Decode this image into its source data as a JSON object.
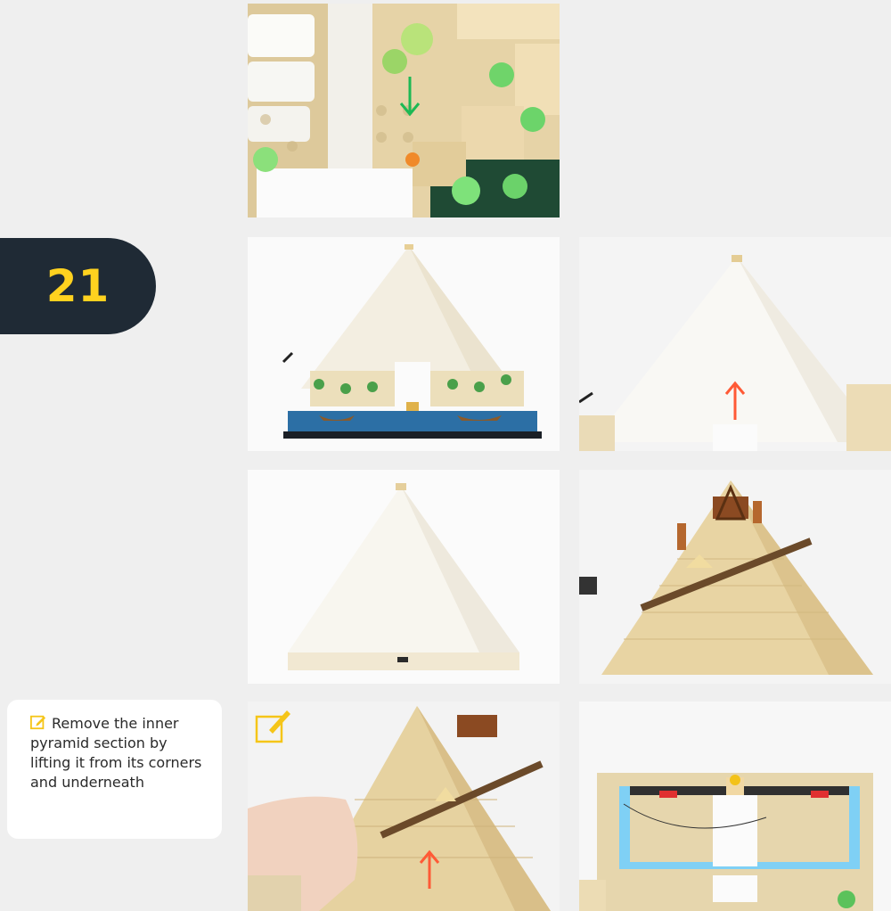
{
  "step": {
    "number": "21"
  },
  "note": {
    "icon": "edit-note-icon",
    "text": "Remove the inner pyramid section by lifting it from its corners and underneath"
  },
  "colors": {
    "badge_bg": "#1f2a35",
    "badge_text": "#ffd21f",
    "note_icon": "#f5c518",
    "arrow_green": "#1db954",
    "arrow_red": "#ff5a36",
    "page_bg": "#efefef"
  },
  "photos": [
    {
      "id": "top-closeup",
      "arrow": "down",
      "arrow_color": "green"
    },
    {
      "id": "full-model-front",
      "arrow": null
    },
    {
      "id": "pyramid-lift-up",
      "arrow": "up",
      "arrow_color": "red"
    },
    {
      "id": "pyramid-isolated",
      "arrow": null
    },
    {
      "id": "inner-pyramid-detail",
      "arrow": null
    },
    {
      "id": "hand-lifting-inner",
      "arrow": "up",
      "arrow_color": "red",
      "note_badge": "edit-note-icon"
    },
    {
      "id": "base-frame-view",
      "arrow": null
    }
  ]
}
